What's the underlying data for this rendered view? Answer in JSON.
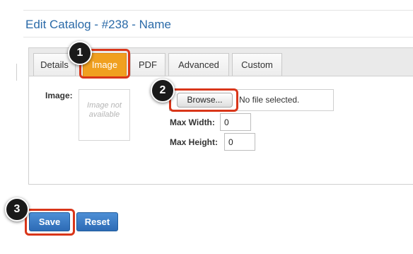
{
  "page": {
    "title": "Edit Catalog - #238 - Name"
  },
  "tabs": [
    {
      "label": "Details",
      "active": false
    },
    {
      "label": "Image",
      "active": true
    },
    {
      "label": "PDF",
      "active": false
    },
    {
      "label": "Advanced",
      "active": false
    },
    {
      "label": "Custom",
      "active": false
    }
  ],
  "image_section": {
    "label": "Image:",
    "placeholder_text": "Image not available",
    "browse_label": "Browse...",
    "file_status": "No file selected.",
    "max_width_label": "Max Width:",
    "max_width_value": "0",
    "max_height_label": "Max Height:",
    "max_height_value": "0"
  },
  "actions": {
    "save_label": "Save",
    "reset_label": "Reset"
  },
  "annotations": {
    "step1": "1",
    "step2": "2",
    "step3": "3",
    "highlight_color": "#d9361a"
  },
  "colors": {
    "title": "#2a6aa8",
    "active_tab": "#f0a020",
    "primary_button": "#2d6bb5"
  }
}
